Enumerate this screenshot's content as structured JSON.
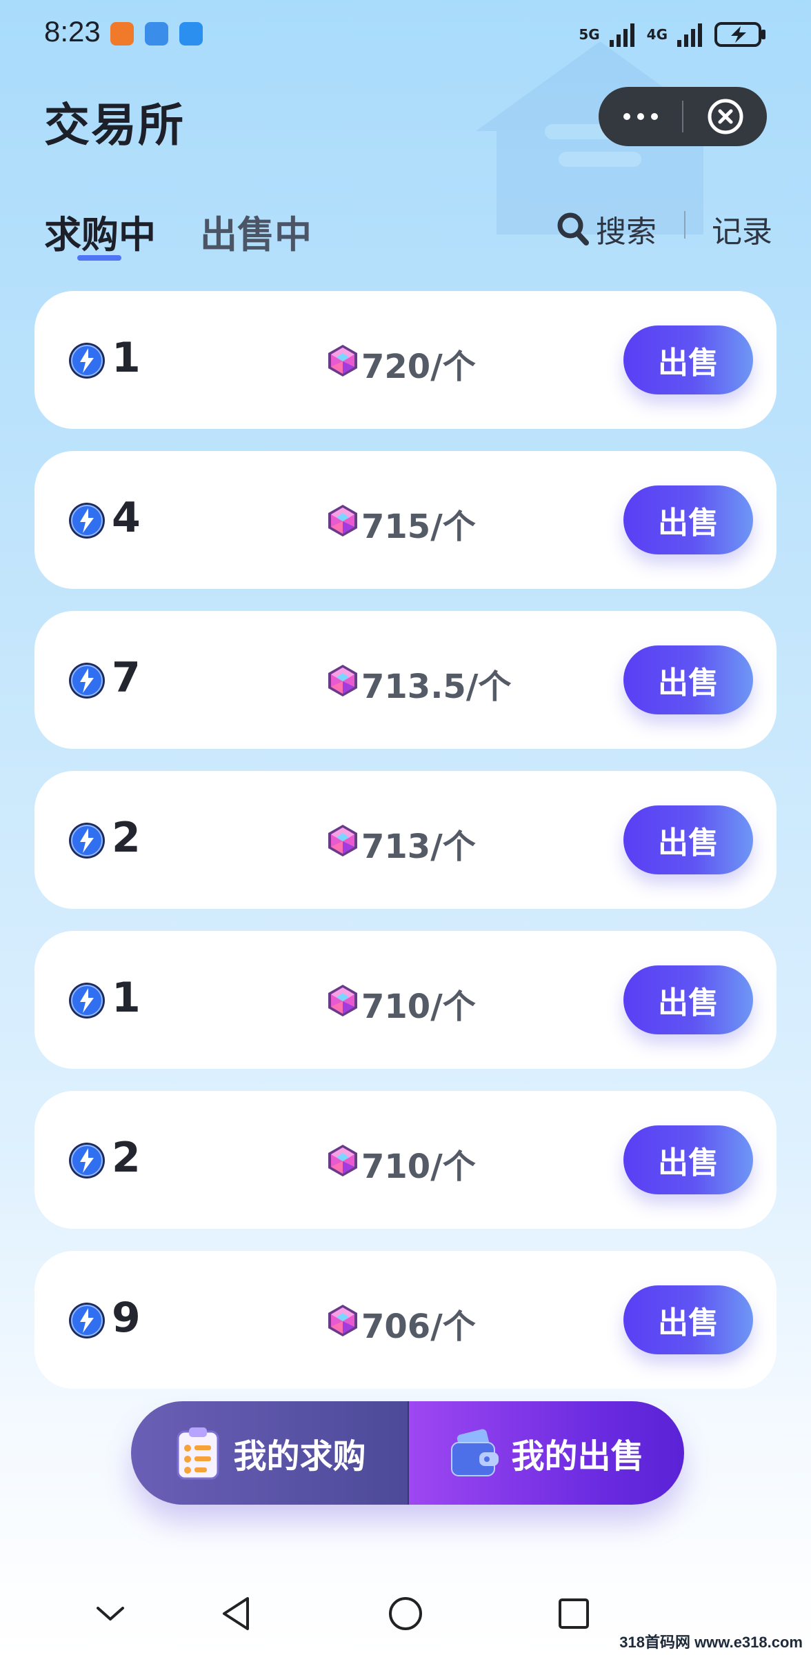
{
  "status_bar": {
    "time": "8:23",
    "network_1": "5G",
    "network_2": "4G"
  },
  "header": {
    "title": "交易所"
  },
  "tabs": [
    {
      "label": "求购中",
      "active": true
    },
    {
      "label": "出售中",
      "active": false
    }
  ],
  "toolbar": {
    "search_label": "搜索",
    "record_label": "记录"
  },
  "orders": [
    {
      "quantity": "1",
      "price": "720/个",
      "action": "出售"
    },
    {
      "quantity": "4",
      "price": "715/个",
      "action": "出售"
    },
    {
      "quantity": "7",
      "price": "713.5/个",
      "action": "出售"
    },
    {
      "quantity": "2",
      "price": "713/个",
      "action": "出售"
    },
    {
      "quantity": "1",
      "price": "710/个",
      "action": "出售"
    },
    {
      "quantity": "2",
      "price": "710/个",
      "action": "出售"
    },
    {
      "quantity": "9",
      "price": "706/个",
      "action": "出售"
    }
  ],
  "bottom_bar": {
    "my_buy_label": "我的求购",
    "my_sell_label": "我的出售"
  },
  "watermark": "318首码网 www.e318.com",
  "icons": {
    "quantity": "lightning-coin-icon",
    "price": "pink-gem-icon"
  },
  "colors": {
    "accent": "#4f74f6",
    "sell_button": "#5a3ff5",
    "my_sell": "#8a3cee"
  }
}
